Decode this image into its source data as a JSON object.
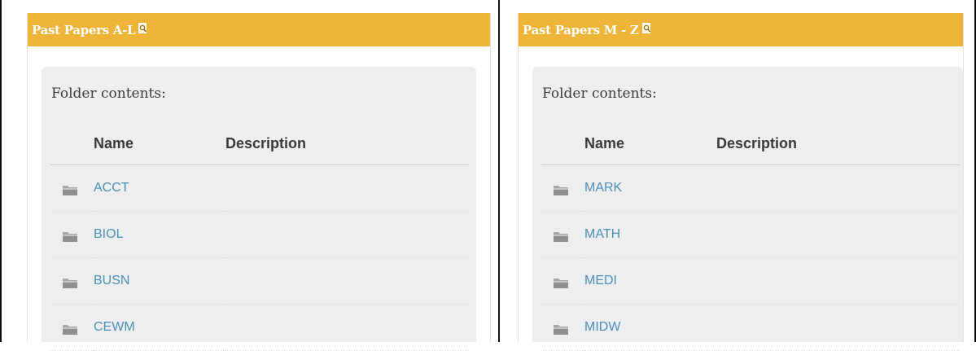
{
  "panels": [
    {
      "title": "Past Papers A-L",
      "title_icon": "search-icon",
      "folder_heading": "Folder contents:",
      "columns": {
        "name": "Name",
        "description": "Description"
      },
      "items": [
        {
          "icon": "folder-icon",
          "name": "ACCT",
          "description": ""
        },
        {
          "icon": "folder-icon",
          "name": "BIOL",
          "description": ""
        },
        {
          "icon": "folder-icon",
          "name": "BUSN",
          "description": ""
        },
        {
          "icon": "folder-icon",
          "name": "CEWM",
          "description": ""
        }
      ]
    },
    {
      "title": "Past Papers M - Z",
      "title_icon": "search-icon",
      "folder_heading": "Folder contents:",
      "columns": {
        "name": "Name",
        "description": "Description"
      },
      "items": [
        {
          "icon": "folder-icon",
          "name": "MARK",
          "description": ""
        },
        {
          "icon": "folder-icon",
          "name": "MATH",
          "description": ""
        },
        {
          "icon": "folder-icon",
          "name": "MEDI",
          "description": ""
        },
        {
          "icon": "folder-icon",
          "name": "MIDW",
          "description": ""
        }
      ]
    }
  ],
  "colors": {
    "header_bg": "#edb437",
    "link": "#4a90b8",
    "box_bg": "#eeeeee"
  }
}
